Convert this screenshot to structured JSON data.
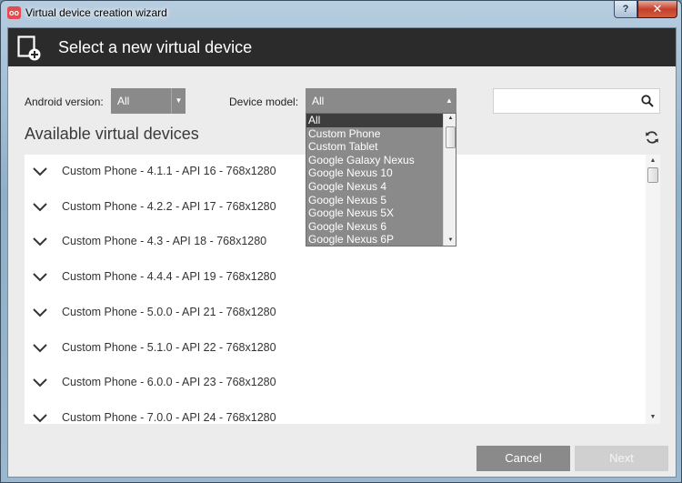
{
  "window": {
    "title": "Virtual device creation wizard",
    "app_icon_label": "Genymotion",
    "help_label": "?",
    "close_label": "✕"
  },
  "header": {
    "title": "Select a new virtual device",
    "icon": "add-device-icon"
  },
  "filters": {
    "android_version_label": "Android version:",
    "android_version_value": "All",
    "device_model_label": "Device model:",
    "device_model_value": "All",
    "search_placeholder": ""
  },
  "section_title": "Available virtual devices",
  "devices": [
    "Custom Phone - 4.1.1 - API 16 - 768x1280",
    "Custom Phone - 4.2.2 - API 17 - 768x1280",
    "Custom Phone - 4.3 - API 18 - 768x1280",
    "Custom Phone - 4.4.4 - API 19 - 768x1280",
    "Custom Phone - 5.0.0 - API 21 - 768x1280",
    "Custom Phone - 5.1.0 - API 22 - 768x1280",
    "Custom Phone - 6.0.0 - API 23 - 768x1280",
    "Custom Phone - 7.0.0 - API 24 - 768x1280"
  ],
  "device_model_options": [
    "All",
    "Custom Phone",
    "Custom Tablet",
    "Google Galaxy Nexus",
    "Google Nexus 10",
    "Google Nexus 4",
    "Google Nexus 5",
    "Google Nexus 5X",
    "Google Nexus 6",
    "Google Nexus 6P"
  ],
  "device_model_selected": "All",
  "buttons": {
    "cancel": "Cancel",
    "next": "Next"
  },
  "colors": {
    "header_bg": "#2b2b2b",
    "select_bg": "#8a8a8a",
    "selected_option_bg": "#3d3d3d",
    "app_icon": "#e8494f"
  }
}
